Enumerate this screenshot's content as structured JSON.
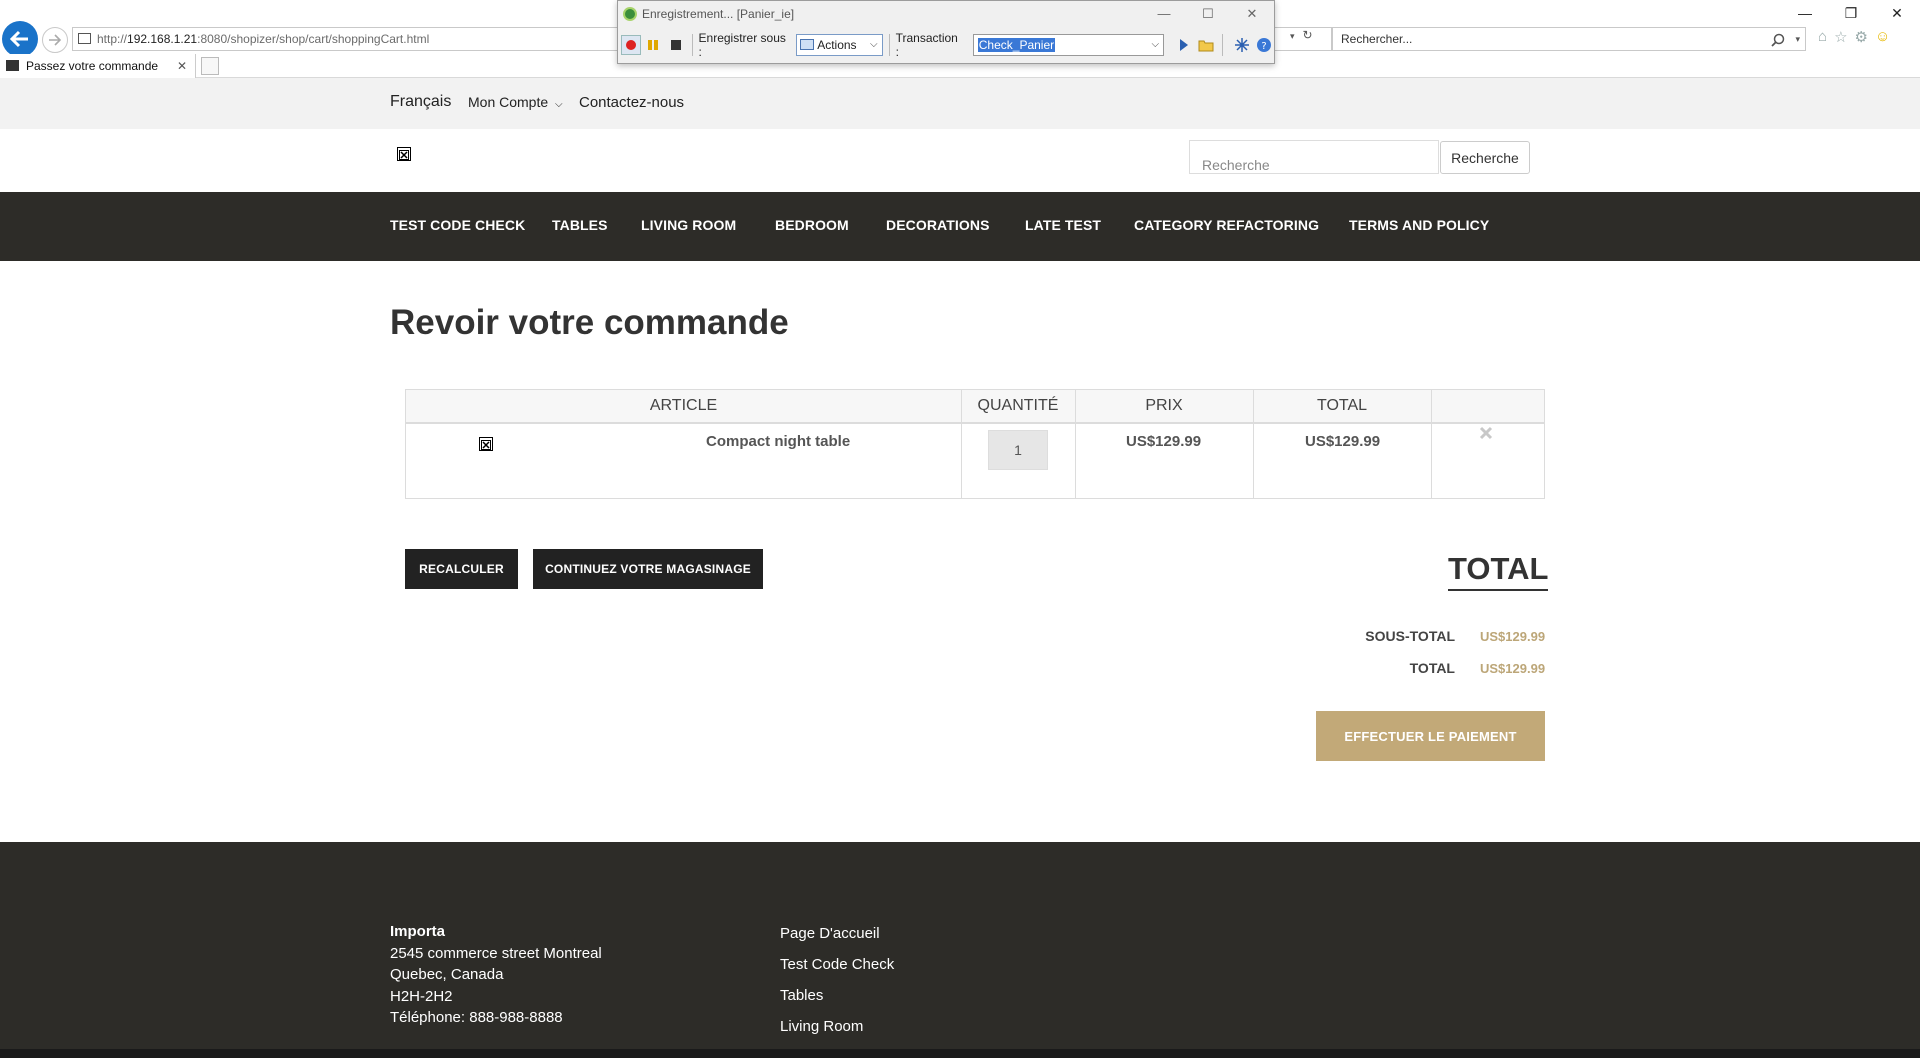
{
  "browser": {
    "url_prefix": "http://",
    "url_host": "192.168.1.21",
    "url_rest": ":8080/shopizer/shop/cart/shoppingCart.html",
    "search_placeholder": "Rechercher...",
    "tab_title": "Passez votre commande"
  },
  "recorder": {
    "title": "Enregistrement... [Panier_ie]",
    "save_under_label": "Enregistrer sous :",
    "save_under_value": "Actions",
    "transaction_label": "Transaction :",
    "transaction_value": "Check_Panier"
  },
  "topbar": {
    "language": "Français",
    "account": "Mon Compte",
    "contact": "Contactez-nous"
  },
  "header": {
    "search_placeholder": "Recherche",
    "search_button": "Recherche"
  },
  "categories": [
    "TEST CODE CHECK",
    "TABLES",
    "LIVING ROOM",
    "BEDROOM",
    "DECORATIONS",
    "LATE TEST",
    "CATEGORY REFACTORING",
    "TERMS AND POLICY"
  ],
  "page_title": "Revoir votre commande",
  "cart": {
    "headers": [
      "ARTICLE",
      "QUANTITÉ",
      "PRIX",
      "TOTAL"
    ],
    "items": [
      {
        "name": "Compact night table",
        "quantity": "1",
        "price": "US$129.99",
        "total": "US$129.99"
      }
    ]
  },
  "buttons": {
    "recalculate": "RECALCULER",
    "continue_shopping": "CONTINUEZ VOTRE MAGASINAGE",
    "pay": "EFFECTUER LE PAIEMENT"
  },
  "summary": {
    "title": "TOTAL",
    "subtotal_label": "SOUS-TOTAL",
    "subtotal_value": "US$129.99",
    "total_label": "TOTAL",
    "total_value": "US$129.99"
  },
  "footer": {
    "company": "Importa",
    "address_lines": [
      "2545 commerce street Montreal",
      "Quebec, Canada",
      "H2H-2H2",
      "Téléphone: 888-988-8888"
    ],
    "links": [
      "Page D'accueil",
      "Test Code Check",
      "Tables",
      "Living Room"
    ]
  },
  "colors": {
    "nav_dark": "#2d2c28",
    "accent_gold": "#c2a978",
    "price_gold": "#bca678",
    "browser_back": "#1a73c9"
  }
}
